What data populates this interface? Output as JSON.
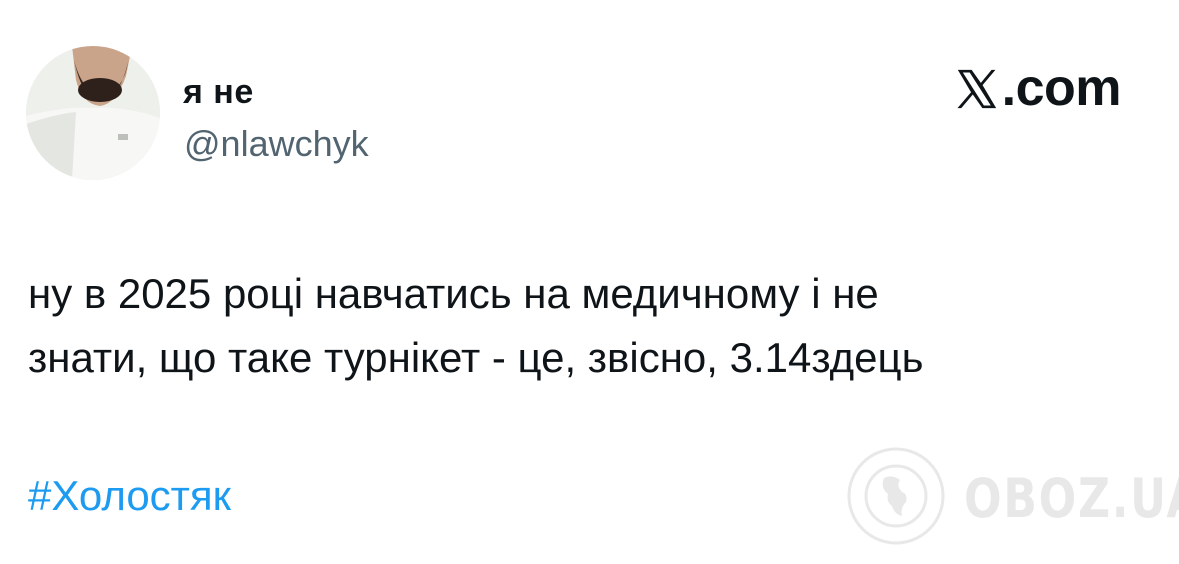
{
  "author": {
    "display_name": "я не",
    "handle": "@nlawchyk"
  },
  "brand": {
    "label": ".com",
    "icon": "x-logo-icon"
  },
  "tweet": {
    "text_line1": "ну в 2025 році навчатись на медичному і не",
    "text_line2": "знати, що таке турнікет - це, звісно, 3.14здець",
    "hashtag": "#Холостяк"
  },
  "watermark": {
    "label": "OBOZ.UA",
    "icon": "globe-icon"
  },
  "colors": {
    "text": "#0f1419",
    "handle": "#536471",
    "hashtag": "#1d9bf0"
  }
}
